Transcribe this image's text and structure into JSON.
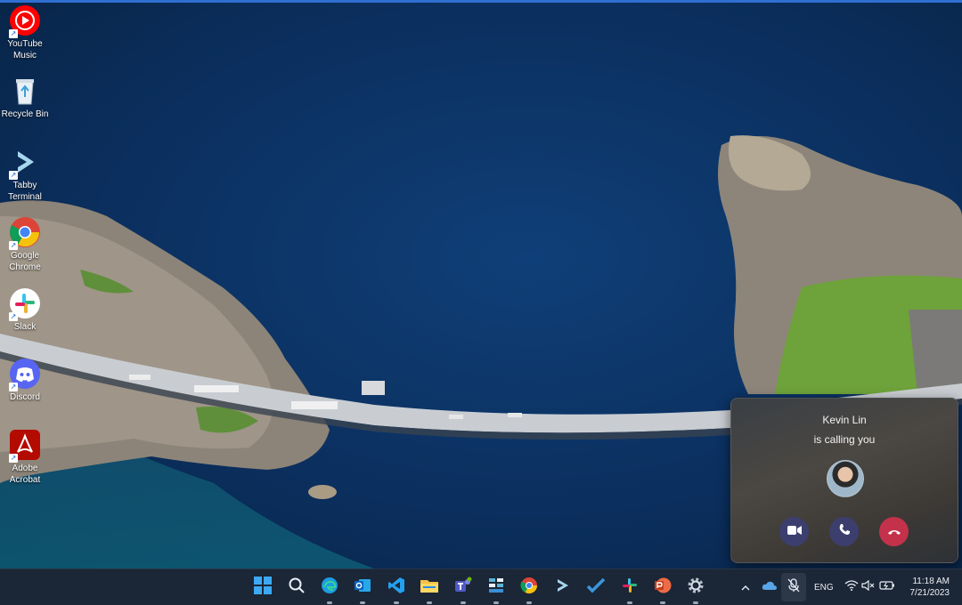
{
  "desktop": {
    "icons": [
      {
        "label": "YouTube Music",
        "icon": "youtube-music-icon"
      },
      {
        "label": "Recycle Bin",
        "icon": "recycle-bin-icon"
      },
      {
        "label": "Tabby Terminal",
        "icon": "tabby-terminal-icon"
      },
      {
        "label": "Google Chrome",
        "icon": "chrome-icon"
      },
      {
        "label": "Slack",
        "icon": "slack-icon"
      },
      {
        "label": "Discord",
        "icon": "discord-icon"
      },
      {
        "label": "Adobe Acrobat",
        "icon": "adobe-acrobat-icon"
      }
    ]
  },
  "call": {
    "caller": "Kevin Lin",
    "status": "is calling you",
    "buttons": {
      "video": "video-call-icon",
      "audio": "phone-icon",
      "decline": "hang-up-icon"
    }
  },
  "taskbar": {
    "apps": [
      "start-icon",
      "search-icon",
      "edge-icon",
      "outlook-icon",
      "vscode-icon",
      "file-explorer-icon",
      "teams-icon",
      "azure-icon",
      "chrome-icon",
      "tabby-icon",
      "todo-icon",
      "slack-icon",
      "powerpoint-icon",
      "settings-icon"
    ],
    "tray": {
      "language": "ENG",
      "time": "11:18 AM",
      "date": "7/21/2023"
    }
  },
  "colors": {
    "accent": "#2f6fd1",
    "decline": "#c4314b",
    "call_button": "#3c3f6e"
  }
}
